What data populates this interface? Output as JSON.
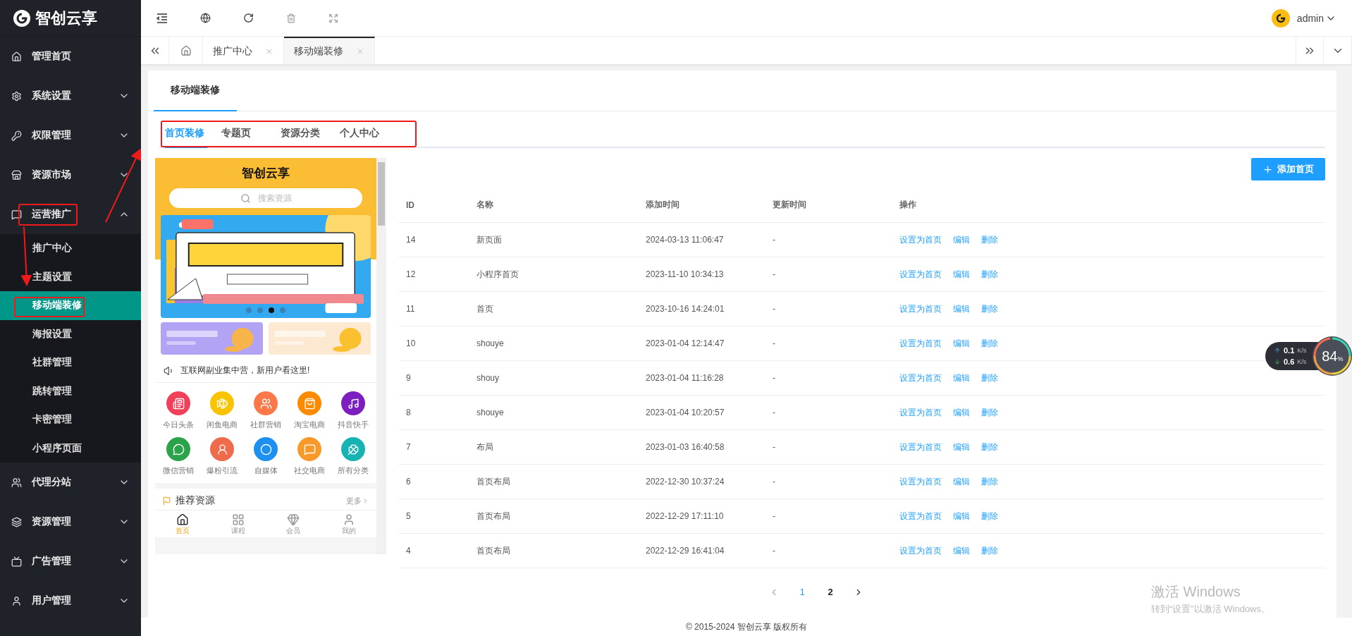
{
  "brand": {
    "name": "智创云享"
  },
  "sidebar": {
    "items": [
      {
        "label": "管理首页",
        "selected": false
      },
      {
        "label": "系统设置",
        "selected": false,
        "expanded": false
      },
      {
        "label": "权限管理",
        "selected": false,
        "expanded": false
      },
      {
        "label": "资源市场",
        "selected": false,
        "expanded": false
      },
      {
        "label": "运营推广",
        "selected": false,
        "expanded": true,
        "children": [
          {
            "label": "推广中心",
            "selected": false
          },
          {
            "label": "主题设置",
            "selected": false
          },
          {
            "label": "移动端装修",
            "selected": true
          },
          {
            "label": "海报设置",
            "selected": false
          },
          {
            "label": "社群管理",
            "selected": false
          },
          {
            "label": "跳转管理",
            "selected": false
          },
          {
            "label": "卡密管理",
            "selected": false
          },
          {
            "label": "小程序页面",
            "selected": false
          }
        ]
      },
      {
        "label": "代理分站",
        "selected": false,
        "expanded": false
      },
      {
        "label": "资源管理",
        "selected": false,
        "expanded": false
      },
      {
        "label": "广告管理",
        "selected": false,
        "expanded": false
      },
      {
        "label": "用户管理",
        "selected": false,
        "expanded": false
      }
    ]
  },
  "user": {
    "name": "admin"
  },
  "page_tabs": [
    {
      "label": "推广中心",
      "selected": false
    },
    {
      "label": "移动端装修",
      "selected": true
    }
  ],
  "card_title": "移动端装修",
  "tabs": [
    {
      "label": "首页装修",
      "selected": true
    },
    {
      "label": "专题页",
      "selected": false
    },
    {
      "label": "资源分类",
      "selected": false
    },
    {
      "label": "个人中心",
      "selected": false
    }
  ],
  "preview": {
    "title": "智创云享",
    "search_placeholder": "搜索资源",
    "banner_dots": [
      {
        "selected": false
      },
      {
        "selected": false
      },
      {
        "selected": true
      },
      {
        "selected": false
      }
    ],
    "notice": "互联网副业集中营，新用户看这里!",
    "grid": [
      {
        "label": "今日头条",
        "color": "#f0405a"
      },
      {
        "label": "闲鱼电商",
        "color": "#f8c400"
      },
      {
        "label": "社群营销",
        "color": "#fb7849"
      },
      {
        "label": "淘宝电商",
        "color": "#fb8a00"
      },
      {
        "label": "抖音快手",
        "color": "#7d1ec0"
      },
      {
        "label": "微信营销",
        "color": "#2aa34a"
      },
      {
        "label": "爆粉引流",
        "color": "#f06a4c"
      },
      {
        "label": "自媒体",
        "color": "#1e90f0"
      },
      {
        "label": "社交电商",
        "color": "#f89a2a"
      },
      {
        "label": "所有分类",
        "color": "#17b3b3"
      }
    ],
    "section": {
      "title": "推荐资源",
      "more": "更多"
    },
    "nav": [
      {
        "label": "首页",
        "selected": true
      },
      {
        "label": "课程",
        "selected": false
      },
      {
        "label": "会员",
        "selected": false
      },
      {
        "label": "我的",
        "selected": false
      }
    ]
  },
  "add_button": "添加首页",
  "table": {
    "columns": [
      "ID",
      "名称",
      "添加时间",
      "更新时间",
      "操作"
    ],
    "rows": [
      {
        "id": "14",
        "name": "新页面",
        "added": "2024-03-13 11:06:47",
        "updated": "-",
        "actions": [
          "设置为首页",
          "编辑",
          "删除"
        ]
      },
      {
        "id": "12",
        "name": "小程序首页",
        "added": "2023-11-10 10:34:13",
        "updated": "-",
        "actions": [
          "设置为首页",
          "编辑",
          "删除"
        ]
      },
      {
        "id": "11",
        "name": "首页",
        "added": "2023-10-16 14:24:01",
        "updated": "-",
        "actions": [
          "设置为首页",
          "编辑",
          "删除"
        ]
      },
      {
        "id": "10",
        "name": "shouye",
        "added": "2023-01-04 12:14:47",
        "updated": "-",
        "actions": [
          "设置为首页",
          "编辑",
          "删除"
        ]
      },
      {
        "id": "9",
        "name": "shouy",
        "added": "2023-01-04 11:16:28",
        "updated": "-",
        "actions": [
          "设置为首页",
          "编辑",
          "删除"
        ]
      },
      {
        "id": "8",
        "name": "shouye",
        "added": "2023-01-04 10:20:57",
        "updated": "-",
        "actions": [
          "设置为首页",
          "编辑",
          "删除"
        ]
      },
      {
        "id": "7",
        "name": "布局",
        "added": "2023-01-03 16:40:58",
        "updated": "-",
        "actions": [
          "设置为首页",
          "编辑",
          "删除"
        ]
      },
      {
        "id": "6",
        "name": "首页布局",
        "added": "2022-12-30 10:37:24",
        "updated": "-",
        "actions": [
          "设置为首页",
          "编辑",
          "删除"
        ]
      },
      {
        "id": "5",
        "name": "首页布局",
        "added": "2022-12-29 17:11:10",
        "updated": "-",
        "actions": [
          "设置为首页",
          "编辑",
          "删除"
        ]
      },
      {
        "id": "4",
        "name": "首页布局",
        "added": "2022-12-29 16:41:04",
        "updated": "-",
        "actions": [
          "设置为首页",
          "编辑",
          "删除"
        ]
      }
    ]
  },
  "pagination": {
    "pages": [
      {
        "label": "1",
        "selected": true
      },
      {
        "label": "2",
        "selected": false
      }
    ]
  },
  "footer": "© 2015-2024 智创云享 版权所有",
  "net_widget": {
    "up": "0.1",
    "up_unit": "K/s",
    "down": "0.6",
    "down_unit": "K/s",
    "percent": "84",
    "percent_sign": "%"
  },
  "watermark": {
    "title": "激活 Windows",
    "subtitle": "转到“设置”以激活 Windows。"
  }
}
